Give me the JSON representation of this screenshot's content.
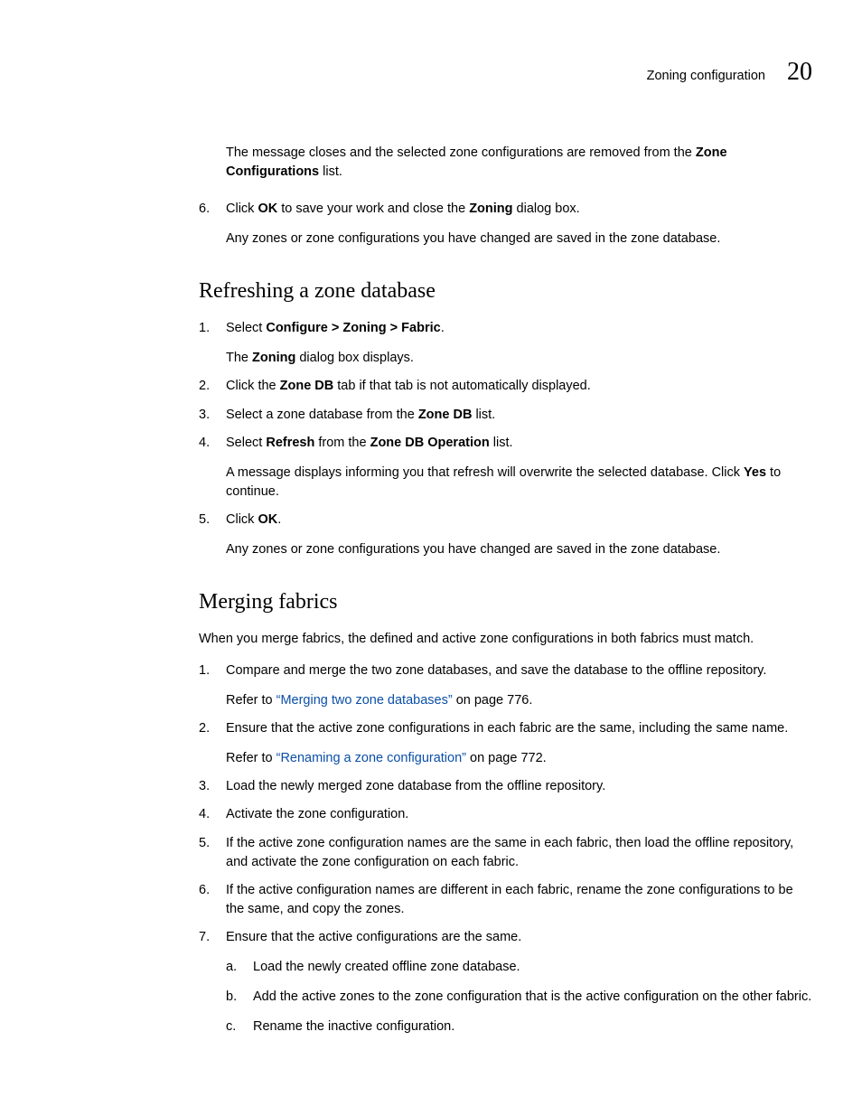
{
  "header": {
    "title": "Zoning configuration",
    "chapter": "20"
  },
  "intro_msg": {
    "pre": "The message closes and the selected zone configurations are removed from the ",
    "bold1": "Zone Configurations",
    "post": " list."
  },
  "list1": {
    "item6": {
      "marker": "6.",
      "pre": "Click ",
      "bold1": "OK",
      "mid": " to save your work and close the ",
      "bold2": "Zoning",
      "post": " dialog box.",
      "follow": "Any zones or zone configurations you have changed are saved in the zone database."
    }
  },
  "section1": {
    "title": "Refreshing a zone database",
    "items": {
      "i1": {
        "marker": "1.",
        "pre": "Select ",
        "bold1": "Configure > Zoning > Fabric",
        "post": ".",
        "follow_pre": "The ",
        "follow_bold": "Zoning",
        "follow_post": " dialog box displays."
      },
      "i2": {
        "marker": "2.",
        "pre": "Click the ",
        "bold1": "Zone DB",
        "post": " tab if that tab is not automatically displayed."
      },
      "i3": {
        "marker": "3.",
        "pre": "Select a zone database from the ",
        "bold1": "Zone DB",
        "post": " list."
      },
      "i4": {
        "marker": "4.",
        "pre": "Select ",
        "bold1": "Refresh",
        "mid": " from the ",
        "bold2": "Zone DB Operation",
        "post": " list.",
        "follow_pre": "A message displays informing you that refresh will overwrite the selected database. Click ",
        "follow_bold": "Yes",
        "follow_post": " to continue."
      },
      "i5": {
        "marker": "5.",
        "pre": "Click ",
        "bold1": "OK",
        "post": ".",
        "follow": "Any zones or zone configurations you have changed are saved in the zone database."
      }
    }
  },
  "section2": {
    "title": "Merging fabrics",
    "intro": "When you merge fabrics, the defined and active zone configurations in both fabrics must match.",
    "items": {
      "i1": {
        "marker": "1.",
        "text": "Compare and merge the two zone databases, and save the database to the offline repository.",
        "follow_pre": "Refer to ",
        "follow_link": "“Merging two zone databases”",
        "follow_post": " on page 776."
      },
      "i2": {
        "marker": "2.",
        "text": "Ensure that the active zone configurations in each fabric are the same, including the same name.",
        "follow_pre": "Refer to ",
        "follow_link": "“Renaming a zone configuration”",
        "follow_post": " on page 772."
      },
      "i3": {
        "marker": "3.",
        "text": "Load the newly merged zone database from the offline repository."
      },
      "i4": {
        "marker": "4.",
        "text": "Activate the zone configuration."
      },
      "i5": {
        "marker": "5.",
        "text": "If the active zone configuration names are the same in each fabric, then load the offline repository, and activate the zone configuration on each fabric."
      },
      "i6": {
        "marker": "6.",
        "text": "If the active configuration names are different in each fabric, rename the zone configurations to be the same, and copy the zones."
      },
      "i7": {
        "marker": "7.",
        "text": "Ensure that the active configurations are the same.",
        "sub": {
          "a": {
            "marker": "a.",
            "text": "Load the newly created offline zone database."
          },
          "b": {
            "marker": "b.",
            "text": "Add the active zones to the zone configuration that is the active configuration on the other fabric."
          },
          "c": {
            "marker": "c.",
            "text": "Rename the inactive configuration."
          }
        }
      }
    }
  }
}
